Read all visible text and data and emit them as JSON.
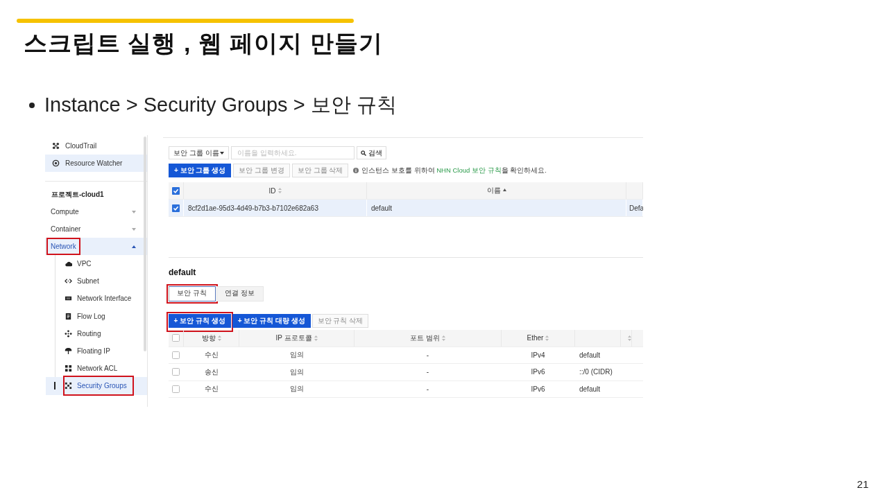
{
  "slide": {
    "title": "스크립트 실행 , 웹 페이지 만들기",
    "bullet": "Instance > Security Groups > 보안 규칙",
    "page_number": "21"
  },
  "sidebar": {
    "items": [
      {
        "label": "CloudTrail",
        "selected": false
      },
      {
        "label": "Resource Watcher",
        "selected": true
      }
    ],
    "project": "프로젝트-cloud1",
    "menus": [
      {
        "label": "Compute",
        "expanded": false,
        "highlighted": false
      },
      {
        "label": "Container",
        "expanded": false,
        "highlighted": false
      },
      {
        "label": "Network",
        "expanded": true,
        "highlighted": true,
        "children": [
          {
            "label": "VPC",
            "selected": false,
            "highlighted": false
          },
          {
            "label": "Subnet",
            "selected": false,
            "highlighted": false
          },
          {
            "label": "Network Interface",
            "selected": false,
            "highlighted": false
          },
          {
            "label": "Flow Log",
            "selected": false,
            "highlighted": false
          },
          {
            "label": "Routing",
            "selected": false,
            "highlighted": false
          },
          {
            "label": "Floating IP",
            "selected": false,
            "highlighted": false
          },
          {
            "label": "Network ACL",
            "selected": false,
            "highlighted": false
          },
          {
            "label": "Security Groups",
            "selected": true,
            "highlighted": true
          }
        ]
      }
    ]
  },
  "filter": {
    "dropdown": "보안 그룹 이름",
    "placeholder": "이름을 입력하세요.",
    "search_button": "검색"
  },
  "group_actions": [
    {
      "label": "+  보안 그룹 생성",
      "kind": "primary"
    },
    {
      "label": "보안 그룹 변경",
      "kind": "disabled"
    },
    {
      "label": "보안 그룹 삭제",
      "kind": "disabled"
    }
  ],
  "notice": {
    "before": "인스턴스 보호를 위하여 ",
    "link": "NHN Cloud 보안 규칙",
    "after": "을 확인하세요."
  },
  "groups_table": {
    "all_checked": true,
    "columns": [
      {
        "label": "ID",
        "sorted_ascending": false
      },
      {
        "label": "이름",
        "sorted_ascending": true
      }
    ],
    "rows": [
      {
        "selected": true,
        "id": "8cf2d1ae-95d3-4d49-b7b3-b7102e682a63",
        "name": "default",
        "column_3": "Defa"
      }
    ]
  },
  "detail": {
    "title": "default",
    "tabs": [
      {
        "label": "보안 규칙",
        "selected": true,
        "highlighted": true
      },
      {
        "label": "연결 정보",
        "selected": false,
        "highlighted": false
      }
    ],
    "actions": [
      {
        "label": "+  보안 규칙 생성",
        "kind": "primary",
        "highlighted": true
      },
      {
        "label": "+  보안 규칙 대량 생성",
        "kind": "primary",
        "highlighted": false
      },
      {
        "label": "보안 규칙 삭제",
        "kind": "disabled",
        "highlighted": false
      }
    ],
    "rules_table": {
      "all_checked": false,
      "columns": [
        "방향",
        "IP 프로토콜",
        "포트 범위",
        "Ether"
      ],
      "rows": [
        {
          "checked": false,
          "direction": "수신",
          "protocol": "임의",
          "port": "-",
          "ether": "IPv4",
          "column_6": "default"
        },
        {
          "checked": false,
          "direction": "송신",
          "protocol": "임의",
          "port": "-",
          "ether": "IPv6",
          "column_6": "::/0 (CIDR)"
        },
        {
          "checked": false,
          "direction": "수신",
          "protocol": "임의",
          "port": "-",
          "ether": "IPv6",
          "column_6": "default"
        }
      ]
    }
  }
}
